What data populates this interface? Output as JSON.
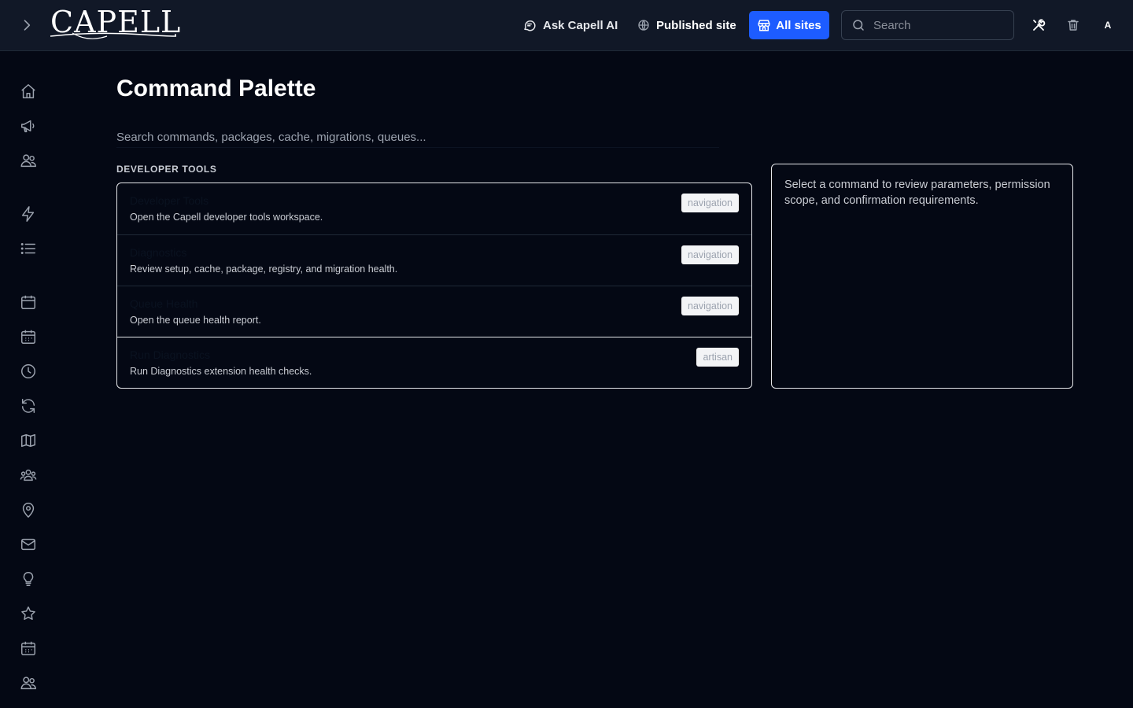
{
  "header": {
    "logo_text": "CAPELL",
    "ask_ai_label": "Ask Capell AI",
    "published_site_label": "Published site",
    "all_sites_label": "All sites",
    "search_placeholder": "Search",
    "avatar_initial": "A"
  },
  "sidebar": {
    "icons": [
      "home-icon",
      "megaphone-icon",
      "users-icon",
      "lightning-icon",
      "list-icon",
      "calendar-icon",
      "calendar-grid-icon",
      "clock-icon",
      "refresh-icon",
      "map-icon",
      "group-icon",
      "map-pin-icon",
      "mail-icon",
      "lightbulb-icon",
      "star-icon",
      "calendar-grid-icon",
      "users-icon"
    ]
  },
  "main": {
    "title": "Command Palette",
    "search_placeholder": "Search commands, packages, cache, migrations, queues...",
    "section_label": "DEVELOPER TOOLS",
    "commands": [
      {
        "title": "Developer Tools",
        "description": "Open the Capell developer tools workspace.",
        "tag": "navigation"
      },
      {
        "title": "Diagnostics",
        "description": "Review setup, cache, package, registry, and migration health.",
        "tag": "navigation"
      },
      {
        "title": "Queue Health",
        "description": "Open the queue health report.",
        "tag": "navigation"
      },
      {
        "title": "Run Diagnostics",
        "description": "Run Diagnostics extension health checks.",
        "tag": "artisan"
      }
    ],
    "detail_hint": "Select a command to review parameters, permission scope, and confirmation requirements."
  },
  "colors": {
    "background": "#040814",
    "topbar": "#111827",
    "accent": "#1d5cff"
  }
}
